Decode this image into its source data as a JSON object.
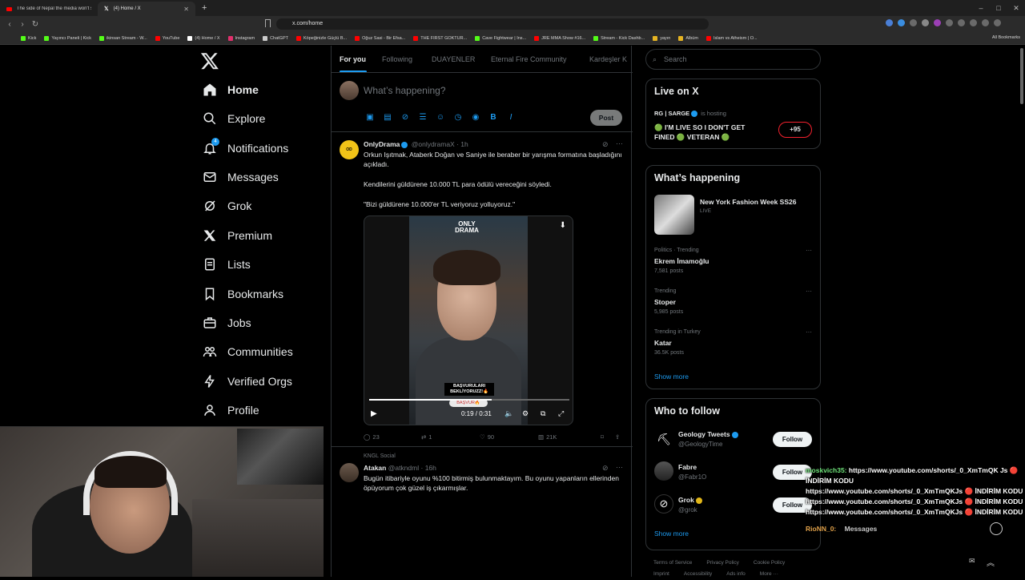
{
  "browser": {
    "tabs": [
      {
        "title": "The side of Nepal the media won't s"
      },
      {
        "title": "(4) Home / X"
      }
    ],
    "new_tab": "+",
    "url": "x.com/home",
    "window_controls": [
      "–",
      "□",
      "✕"
    ],
    "bookmarks": [
      {
        "label": "Kick",
        "color": "#53fc18"
      },
      {
        "label": "Yayıncı Paneli | Kick",
        "color": "#53fc18"
      },
      {
        "label": "ikinsan Stream - W...",
        "color": "#53fc18"
      },
      {
        "label": "YouTube",
        "color": "#ff0000"
      },
      {
        "label": "(4) Home / X",
        "color": "#ffffff"
      },
      {
        "label": "Instagram",
        "color": "#e1306c"
      },
      {
        "label": "ChatGPT",
        "color": "#cccccc"
      },
      {
        "label": "Köpeğinizle Güçlü B...",
        "color": "#ff0000"
      },
      {
        "label": "Oğuz Sasi - Bir Efsa...",
        "color": "#ff0000"
      },
      {
        "label": "THE FIRST GOKTUR...",
        "color": "#ff0000"
      },
      {
        "label": "Cave Fightwear | Ins...",
        "color": "#53fc18"
      },
      {
        "label": "JRE MMA Show #16...",
        "color": "#ff0000"
      },
      {
        "label": "Stream - Kick Dashb...",
        "color": "#53fc18"
      },
      {
        "label": "yayın",
        "color": "#e6b422"
      },
      {
        "label": "Albüm",
        "color": "#e6b422"
      },
      {
        "label": "Islam vs Atheism | O...",
        "color": "#ff0000"
      }
    ],
    "all_bookmarks": "All Bookmarks"
  },
  "nav": {
    "items": [
      {
        "label": "Home",
        "icon": "home-icon"
      },
      {
        "label": "Explore",
        "icon": "search-icon"
      },
      {
        "label": "Notifications",
        "icon": "bell-icon",
        "badge": "4"
      },
      {
        "label": "Messages",
        "icon": "mail-icon"
      },
      {
        "label": "Grok",
        "icon": "grok-icon"
      },
      {
        "label": "Premium",
        "icon": "x-icon"
      },
      {
        "label": "Lists",
        "icon": "list-icon"
      },
      {
        "label": "Bookmarks",
        "icon": "bookmark-icon"
      },
      {
        "label": "Jobs",
        "icon": "briefcase-icon"
      },
      {
        "label": "Communities",
        "icon": "people-icon"
      },
      {
        "label": "Verified Orgs",
        "icon": "lightning-icon"
      },
      {
        "label": "Profile",
        "icon": "person-icon"
      }
    ]
  },
  "timeline": {
    "tabs": [
      "For you",
      "Following",
      "DUAYENLER",
      "Eternal Fire Community",
      "Kardeşler K"
    ],
    "compose_placeholder": "What’s happening?",
    "post_label": "Post",
    "tweet1": {
      "name": "OnlyDrama",
      "handle": "@onlydramaX",
      "time": "· 1h",
      "text1": "Orkun Işıtmak, Ataberk Doğan ve Saniye ile beraber bir yarışma formatına başladığını açıkladı.",
      "text2": "Kendilerini güldürene 10.000 TL para ödülü vereceğini söyledi.",
      "text3": "\"Bizi güldürene 10.000'er TL veriyoruz yolluyoruz.\"",
      "video_brand": "ONLY DRAMA",
      "video_caption": "BAŞVURULARI BEKLİYORUZZ!🔥",
      "video_cta": "BAŞVUR🔥",
      "video_time": "0:19 / 0:31",
      "video_progress": 0.61,
      "replies": "23",
      "reposts": "1",
      "likes": "90",
      "views": "21K"
    },
    "tweet2": {
      "context": "KNGL Social",
      "name": "Atakan",
      "handle": "@atkndml",
      "time": "· 16h",
      "text": "Bugün itibariyle oyunu %100 bitirmiş bulunmaktayım. Bu oyunu yapanların ellerinden öpüyorum çok güzel iş çıkarmışlar."
    }
  },
  "sidebar": {
    "search_placeholder": "Search",
    "live": {
      "title": "Live on X",
      "host": "RG | SARGE",
      "hosting": "is hosting",
      "text": "🟢 I'M LIVE SO I DON'T GET FINED 🟢 VETERAN 🟢",
      "count": "+95"
    },
    "happening": {
      "title": "What’s happening",
      "event": {
        "name": "New York Fashion Week SS26",
        "status": "LIVE"
      },
      "trends": [
        {
          "context": "Politics · Trending",
          "name": "Ekrem İmamoğlu",
          "count": "7,581 posts"
        },
        {
          "context": "Trending",
          "name": "Stoper",
          "count": "5,985 posts"
        },
        {
          "context": "Trending in Turkey",
          "name": "Katar",
          "count": "36.5K posts"
        }
      ],
      "show_more": "Show more"
    },
    "who_to_follow": {
      "title": "Who to follow",
      "accounts": [
        {
          "name": "Geology Tweets",
          "handle": "@GeologyTime"
        },
        {
          "name": "Fabre",
          "handle": "@Fabr1O"
        },
        {
          "name": "Grok",
          "handle": "@grok"
        }
      ],
      "follow_label": "Follow",
      "show_more": "Show more"
    },
    "footer": [
      "Terms of Service",
      "Privacy Policy",
      "Cookie Policy",
      "Imprint",
      "Accessibility",
      "Ads info",
      "More ···"
    ]
  },
  "chat": {
    "lines": [
      {
        "user": "moskvich35:",
        "text": "https://www.youtube.com/shorts/_0_XmTmQK Js 🔴 İNDİRİM KODU"
      },
      {
        "user": "",
        "text": "https://www.youtube.com/shorts/_0_XmTmQKJs 🔴 İNDİRİM KODU"
      },
      {
        "user": "",
        "text": "https://www.youtube.com/shorts/_0_XmTmQKJs 🔴 İNDİRİM KODU"
      },
      {
        "user": "",
        "text": "https://www.youtube.com/shorts/_0_XmTmQKJs 🔴 İNDİRİM KODU"
      }
    ],
    "last_user": "RioNN_0:",
    "messages_label": "Messages"
  }
}
